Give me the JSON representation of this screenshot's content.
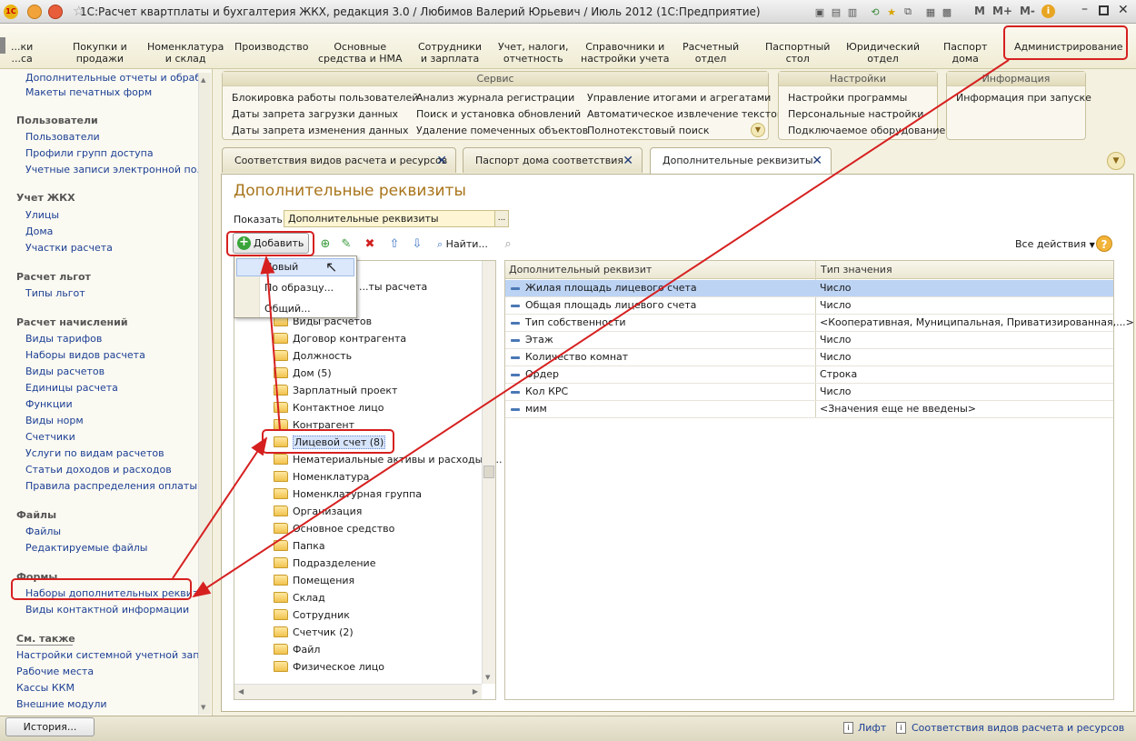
{
  "window": {
    "title": "1С:Расчет квартплаты и бухгалтерия ЖКХ, редакция 3.0 / Любимов Валерий Юрьевич / Июль 2012  (1С:Предприятие)",
    "controls": [
      "M",
      "M+",
      "M-"
    ]
  },
  "sections": [
    {
      "label": "...ки\n...са"
    },
    {
      "label": "Покупки и\nпродажи"
    },
    {
      "label": "Номенклатура\nи склад"
    },
    {
      "label": "Производство"
    },
    {
      "label": "Основные\nсредства и НМА"
    },
    {
      "label": "Сотрудники\nи зарплата"
    },
    {
      "label": "Учет, налоги,\nотчетность"
    },
    {
      "label": "Справочники и\nнастройки учета"
    },
    {
      "label": "Расчетный\nотдел"
    },
    {
      "label": "Паспортный\nстол"
    },
    {
      "label": "Юридический\nотдел"
    },
    {
      "label": "Паспорт\nдома"
    },
    {
      "label": "Администрирование"
    }
  ],
  "panel": {
    "service": {
      "title": "Сервис",
      "col1": [
        "Блокировка работы пользователей",
        "Даты запрета загрузки данных",
        "Даты запрета изменения данных"
      ],
      "col2": [
        "Анализ журнала регистрации",
        "Поиск и установка обновлений",
        "Удаление помеченных объектов"
      ],
      "col3": [
        "Управление итогами и агрегатами",
        "Автоматическое извлечение текстов",
        "Полнотекстовый поиск"
      ]
    },
    "settings": {
      "title": "Настройки",
      "items": [
        "Настройки программы",
        "Персональные настройки",
        "Подключаемое оборудование"
      ]
    },
    "info": {
      "title": "Информация",
      "items": [
        "Информация при запуске"
      ]
    }
  },
  "sidebar": {
    "top": [
      "Дополнительные отчеты и обраб...",
      "Макеты печатных форм"
    ],
    "groups": [
      {
        "title": "Пользователи",
        "items": [
          "Пользователи",
          "Профили групп доступа",
          "Учетные записи электронной по..."
        ]
      },
      {
        "title": "Учет ЖКХ",
        "items": [
          "Улицы",
          "Дома",
          "Участки расчета"
        ]
      },
      {
        "title": "Расчет льгот",
        "items": [
          "Типы льгот"
        ]
      },
      {
        "title": "Расчет начислений",
        "items": [
          "Виды тарифов",
          "Наборы видов расчета",
          "Виды расчетов",
          "Единицы расчета",
          "Функции",
          "Виды норм",
          "Счетчики",
          "Услуги по видам расчетов",
          "Статьи доходов и расходов",
          "Правила распределения оплаты"
        ]
      },
      {
        "title": "Файлы",
        "items": [
          "Файлы",
          "Редактируемые файлы"
        ]
      },
      {
        "title": "Формы",
        "items": [
          "Наборы дополнительных реквиз...",
          "Виды контактной информации"
        ]
      }
    ],
    "see_also": {
      "title": "См. также",
      "items": [
        "Настройки системной учетной зап...",
        "Рабочие места",
        "Кассы ККМ",
        "Внешние модули"
      ]
    }
  },
  "tabs": [
    {
      "label": "Соответствия видов расчета и ресурсов"
    },
    {
      "label": "Паспорт дома соответствия"
    },
    {
      "label": "Дополнительные реквизиты"
    }
  ],
  "form": {
    "title": "Дополнительные реквизиты",
    "show_label": "Показать:",
    "show_value": "Дополнительные реквизиты",
    "add_label": "Добавить",
    "find_label": "Найти...",
    "all_actions": "Все действия",
    "menu": [
      "Новый",
      "По образцу...",
      "Общий..."
    ],
    "tree_partial": "...ты расчета",
    "tree": [
      "Виды расчетов",
      "Договор контрагента",
      "Должность",
      "Дом (5)",
      "Зарплатный проект",
      "Контактное лицо",
      "Контрагент",
      "Лицевой счет (8)",
      "Нематериальные активы и расходы н...",
      "Номенклатура",
      "Номенклатурная группа",
      "Организация",
      "Основное средство",
      "Папка",
      "Подразделение",
      "Помещения",
      "Склад",
      "Сотрудник",
      "Счетчик (2)",
      "Файл",
      "Физическое лицо"
    ],
    "grid": {
      "columns": [
        "Дополнительный реквизит",
        "Тип значения"
      ],
      "rows": [
        [
          "Жилая площадь лицевого счета",
          "Число"
        ],
        [
          "Общая площадь лицевого счета",
          "Число"
        ],
        [
          "Тип собственности",
          "<Кооперативная, Муниципальная, Приватизированная,...>"
        ],
        [
          "Этаж",
          "Число"
        ],
        [
          "Количество комнат",
          "Число"
        ],
        [
          "Ордер",
          "Строка"
        ],
        [
          "Кол КРС",
          "Число"
        ],
        [
          "мим",
          "<Значения еще не введены>"
        ]
      ]
    }
  },
  "status": {
    "history": "История...",
    "lift": "Лифт",
    "hint": "Соответствия видов расчета и ресурсов"
  },
  "colors": {
    "accent_title": "#a8741a",
    "link": "#1c3f94",
    "annotation": "#d62020",
    "selected_row": "#bcd3f3"
  }
}
